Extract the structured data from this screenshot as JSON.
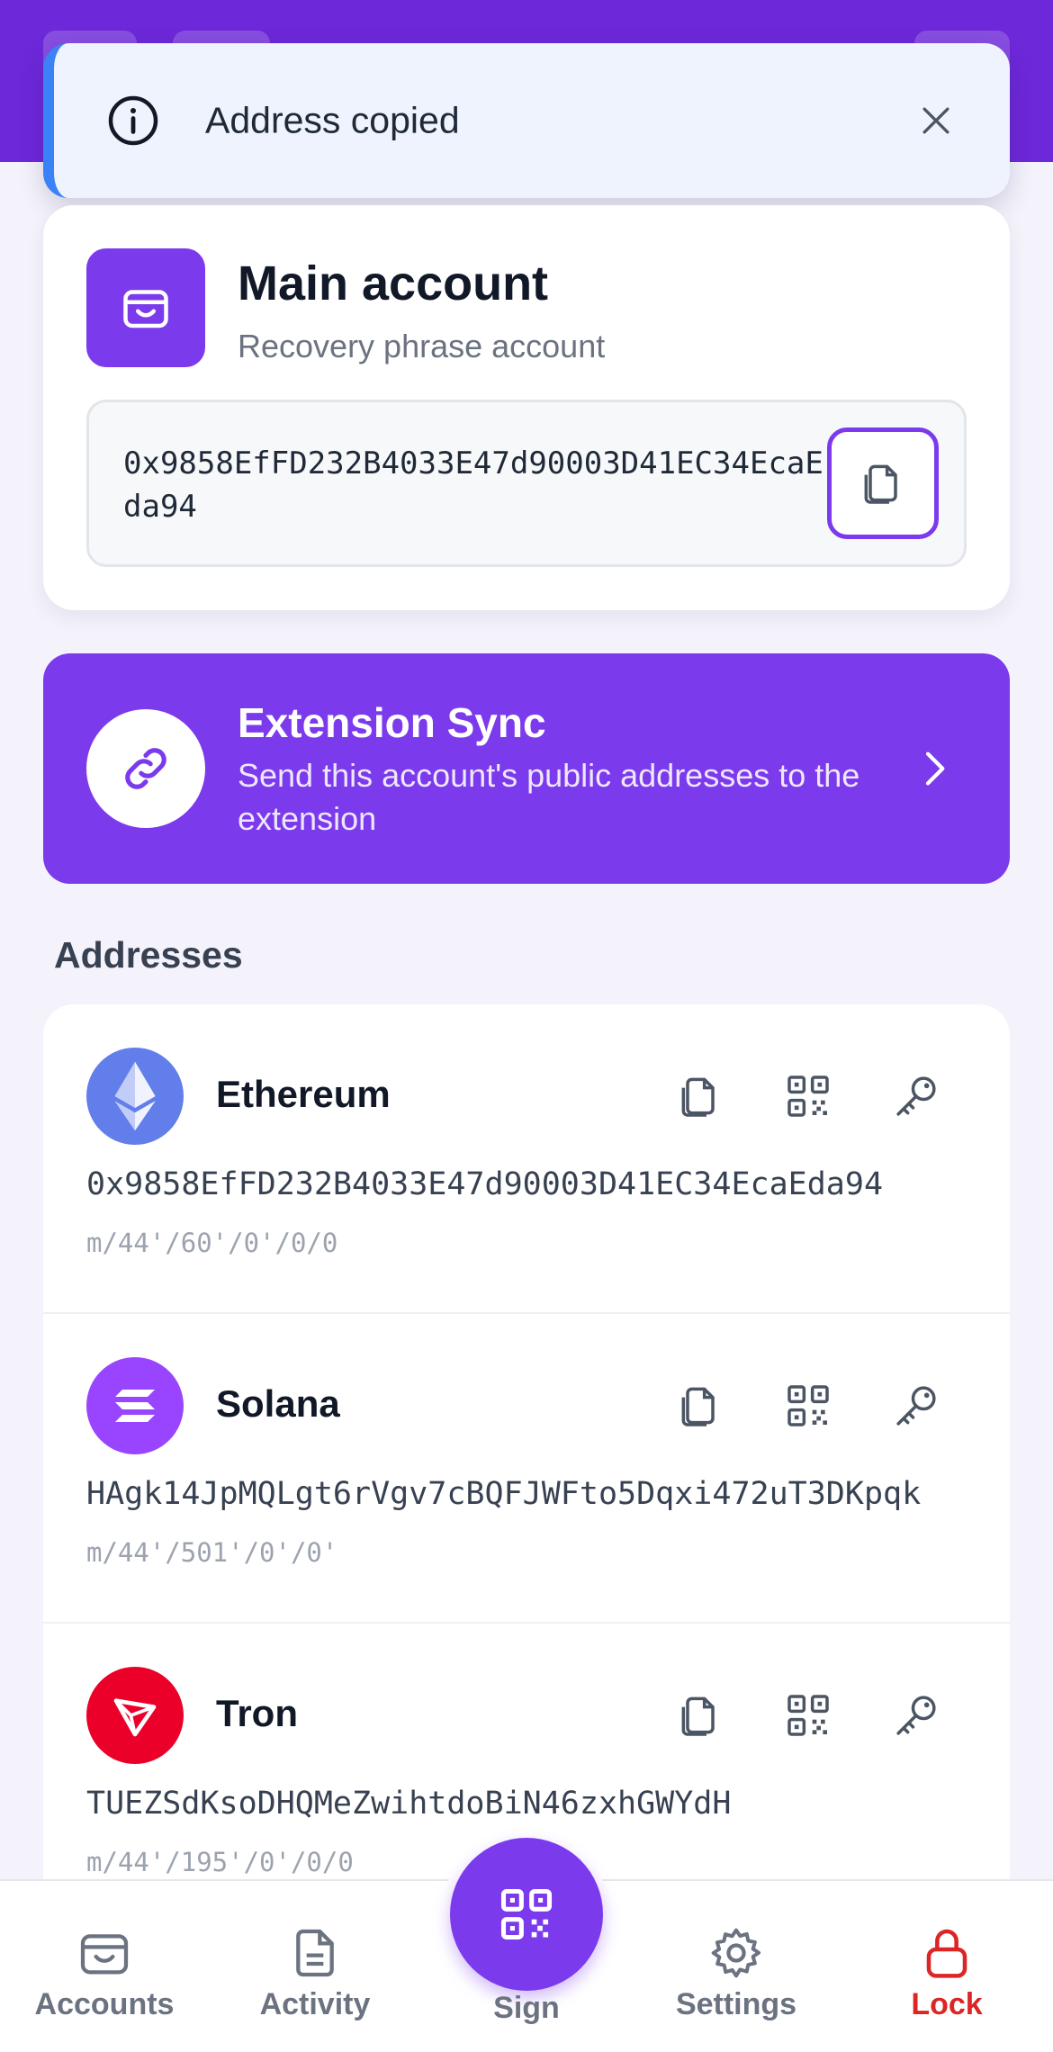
{
  "toast": {
    "message": "Address copied",
    "icon": "info-icon",
    "close_icon": "close-icon"
  },
  "account": {
    "name": "Main account",
    "type": "Recovery phrase account",
    "address": "0x9858EfFD232B4033E47d90003D41EC34EcaEda94",
    "avatar_icon": "wallet-icon",
    "copy_icon": "copy-icon"
  },
  "sync": {
    "title": "Extension Sync",
    "description": "Send this account's public addresses to the extension",
    "icon": "link-icon",
    "chevron_icon": "chevron-right-icon"
  },
  "addresses_section": {
    "title": "Addresses"
  },
  "addresses": [
    {
      "name": "Ethereum",
      "address": "0x9858EfFD232B4033E47d90003D41EC34EcaEda94",
      "path": "m/44'/60'/0'/0/0",
      "icon": "ethereum-icon",
      "color": "#627eea"
    },
    {
      "name": "Solana",
      "address": "HAgk14JpMQLgt6rVgv7cBQFJWFto5Dqxi472uT3DKpqk",
      "path": "m/44'/501'/0'/0'",
      "icon": "solana-icon",
      "color": "#9945ff"
    },
    {
      "name": "Tron",
      "address": "TUEZSdKsoDHQMeZwihtdoBiN46zxhGWYdH",
      "path": "m/44'/195'/0'/0/0",
      "icon": "tron-icon",
      "color": "#eb0029"
    }
  ],
  "row_actions": [
    "copy-icon",
    "qr-code-icon",
    "key-icon"
  ],
  "nav": {
    "accounts": "Accounts",
    "activity": "Activity",
    "sign": "Sign",
    "settings": "Settings",
    "lock": "Lock"
  },
  "colors": {
    "accent": "#7c3aed",
    "header": "#6d28d9",
    "toast_bg": "#eef3fd",
    "lock": "#dc2626"
  }
}
